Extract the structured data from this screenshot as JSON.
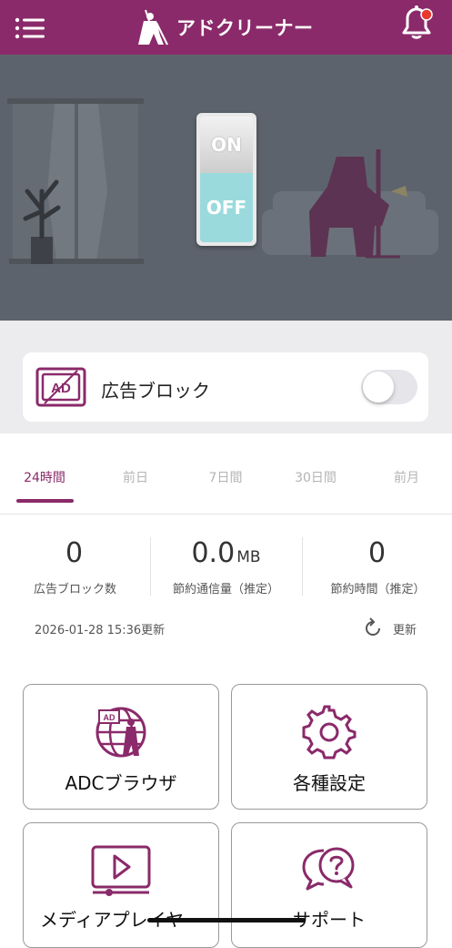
{
  "header": {
    "app_title": "アドクリーナー",
    "menu_icon": "hamburger-menu-icon",
    "bell_icon": "notification-bell-icon",
    "colors": {
      "brand": "#8a2a6a",
      "badge": "#e8392f"
    }
  },
  "hero": {
    "switch_on_label": "ON",
    "switch_off_label": "OFF",
    "switch_state": "off",
    "colors": {
      "background": "#5d636c",
      "off_fill": "#9adadd"
    }
  },
  "adblock": {
    "label": "広告ブロック",
    "icon_text": "AD",
    "enabled": false
  },
  "tabs": [
    {
      "label": "24時間",
      "active": true
    },
    {
      "label": "前日",
      "active": false
    },
    {
      "label": "7日間",
      "active": false
    },
    {
      "label": "30日間",
      "active": false
    },
    {
      "label": "前月",
      "active": false
    }
  ],
  "stats": [
    {
      "value": "0",
      "unit": "",
      "label": "広告ブロック数"
    },
    {
      "value": "0.0",
      "unit": "MB",
      "label": "節約通信量（推定）"
    },
    {
      "value": "0",
      "unit": "",
      "label": "節約時間（推定）"
    }
  ],
  "updated": {
    "timestamp": "2026-01-28 15:36更新",
    "refresh_label": "更新"
  },
  "features": [
    {
      "label": "ADCブラウザ",
      "icon": "globe-browser-icon",
      "icon_text": "AD"
    },
    {
      "label": "各種設定",
      "icon": "gear-icon"
    },
    {
      "label": "メディアプレイヤー",
      "icon": "media-player-icon"
    },
    {
      "label": "サポート",
      "icon": "support-chat-icon"
    }
  ]
}
